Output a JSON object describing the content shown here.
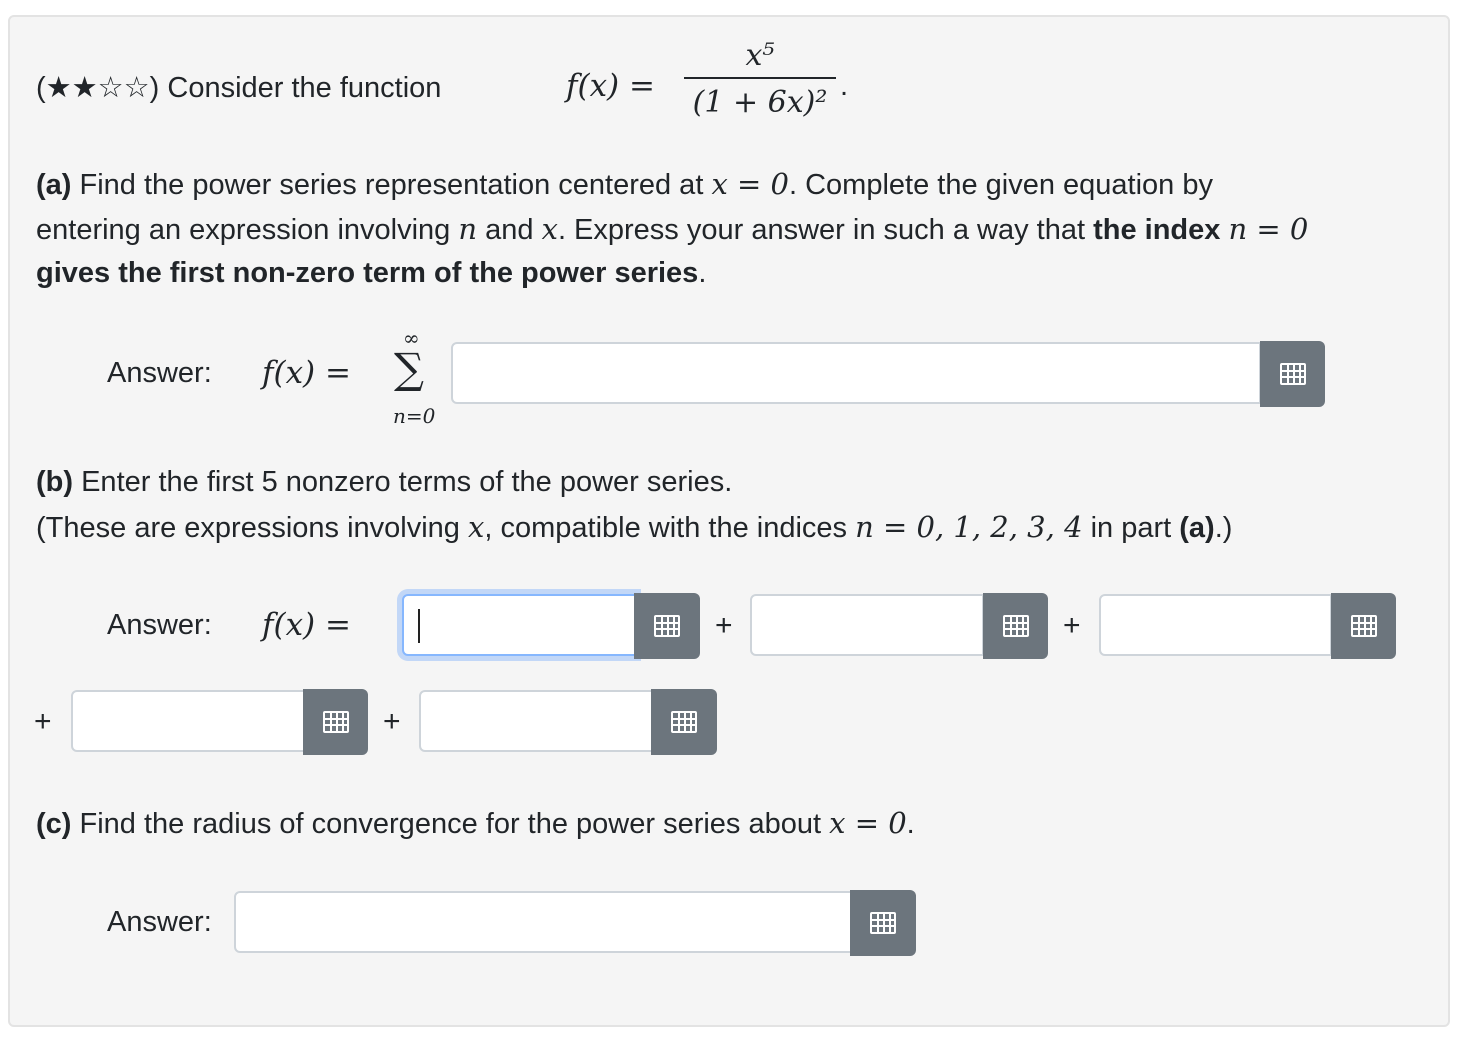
{
  "problem": {
    "rating": "(★★☆☆)",
    "intro": "Consider the function",
    "func_lhs": "f(x) =",
    "numerator": "x⁵",
    "denominator": "(1 + 6x)²",
    "period": "."
  },
  "part_a": {
    "label": "(a)",
    "text1": "Find the power series representation centered at",
    "eq1": "x = 0",
    "text2": ". Complete the given equation by",
    "text3": "entering an expression involving",
    "var_n": "n",
    "and": "and",
    "var_x": "x",
    "text4": ". Express your answer in such a way that",
    "bold1": "the index",
    "eq2": "n = 0",
    "bold2": "gives the first non-zero term of the power series",
    "end": ".",
    "answer_label": "Answer:",
    "lhs": "f(x) =",
    "sum_top": "∞",
    "sum_sym": "∑",
    "sum_bottom": "n=0",
    "input_value": ""
  },
  "part_b": {
    "label": "(b)",
    "line1": "Enter the first 5 nonzero terms of the power series.",
    "line2a": "(These are expressions involving",
    "line2_x": "x",
    "line2b": ", compatible with the indices",
    "line2_eq": "n = 0, 1, 2, 3, 4",
    "line2c": "in part",
    "line2_bold": "(a)",
    "line2d": ".)",
    "answer_label": "Answer:",
    "lhs": "f(x) =",
    "plus": "+",
    "inputs": [
      "",
      "",
      "",
      "",
      ""
    ]
  },
  "part_c": {
    "label": "(c)",
    "text": "Find the radius of convergence for the power series about",
    "eq": "x = 0",
    "end": ".",
    "answer_label": "Answer:",
    "input_value": ""
  },
  "icons": {
    "keyboard": "grid-keypad-icon"
  },
  "colors": {
    "button": "#6c757d",
    "focus": "#86b7fe",
    "panel": "#f5f5f5"
  }
}
